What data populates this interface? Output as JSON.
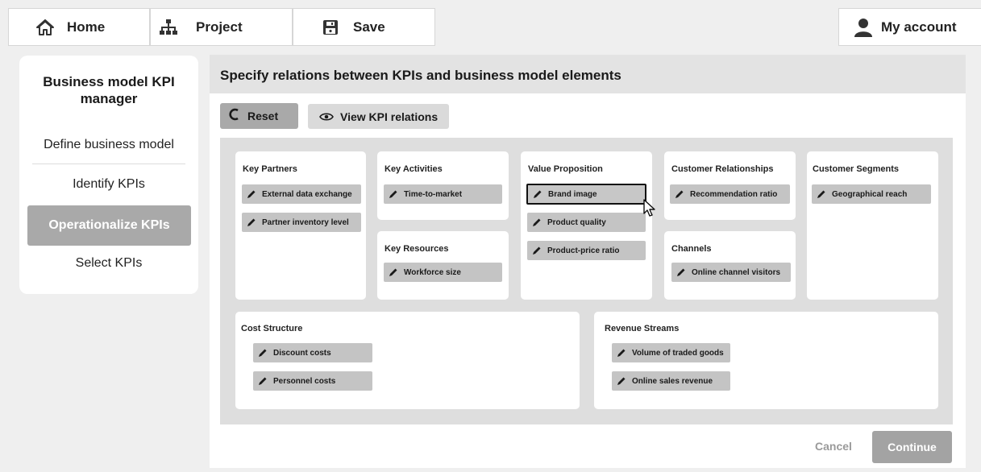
{
  "topbar": {
    "home_label": "Home",
    "project_label": "Project",
    "save_label": "Save",
    "account_label": "My account",
    "icons": [
      "home-icon",
      "sitemap-icon",
      "save-icon",
      "user-icon"
    ]
  },
  "sidebar": {
    "title": "Business model KPI manager",
    "items": [
      {
        "label": "Define business model"
      },
      {
        "label": "Identify KPIs"
      },
      {
        "label": "Operationalize KPIs",
        "active": true
      },
      {
        "label": "Select KPIs"
      }
    ]
  },
  "main": {
    "header": "Specify relations between KPIs and business model elements",
    "reset_label": "Reset",
    "view_label": "View KPI relations",
    "cancel_label": "Cancel",
    "continue_label": "Continue"
  },
  "canvas": {
    "key_partners": {
      "title": "Key Partners",
      "kpis": [
        "External data exchange",
        "Partner inventory level"
      ]
    },
    "key_activities": {
      "title": "Key Activities",
      "kpis": [
        "Time-to-market"
      ]
    },
    "key_resources": {
      "title": "Key Resources",
      "kpis": [
        "Workforce size"
      ]
    },
    "value_proposition": {
      "title": "Value Proposition",
      "kpis": [
        "Brand image",
        "Product quality",
        "Product-price ratio"
      ],
      "selected": "Brand image"
    },
    "customer_relationships": {
      "title": "Customer Relationships",
      "kpis": [
        "Recommendation ratio"
      ]
    },
    "channels": {
      "title": "Channels",
      "kpis": [
        "Online channel visitors"
      ]
    },
    "customer_segments": {
      "title": "Customer Segments",
      "kpis": [
        "Geographical reach"
      ]
    },
    "cost_structure": {
      "title": "Cost Structure",
      "kpis": [
        "Discount costs",
        "Personnel costs"
      ]
    },
    "revenue_streams": {
      "title": "Revenue Streams",
      "kpis": [
        "Volume of traded goods",
        "Online sales revenue"
      ]
    }
  },
  "colors": {
    "accent_gray": "#a9a9a9",
    "chip_gray": "#c4c4c4",
    "canvas_bg": "#dedede"
  }
}
